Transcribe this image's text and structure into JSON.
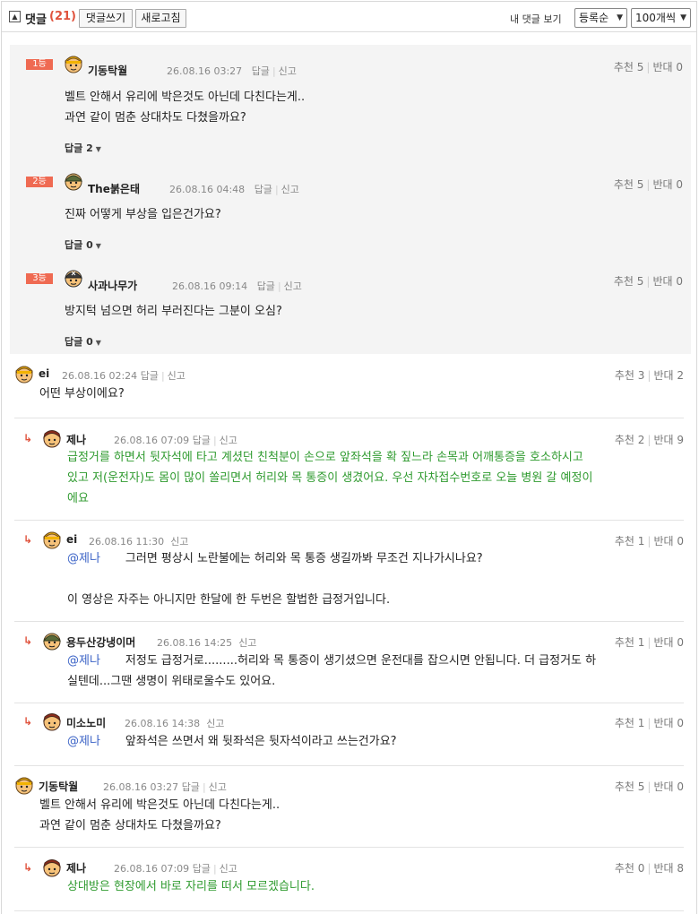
{
  "toolbar": {
    "toggle_icon": "minus-box-icon",
    "title": "댓글",
    "count": "(21)",
    "write_button": "댓글쓰기",
    "refresh_button": "새로고침",
    "my_comments": "내 댓글 보기",
    "order_select": "등록순",
    "count_select": "100개씩"
  },
  "best_comments": [
    {
      "rank": "1등",
      "nick": "기동탁월",
      "date": "26.08.16 03:27",
      "reply_label": "답글",
      "report_label": "신고",
      "up": "추천 5",
      "down": "반대 0",
      "lines": [
        "벨트 안해서 유리에 박은것도 아닌데 다친다는게..",
        "과연 같이 멈춘 상대차도 다쳤을까요?"
      ],
      "replies": "답글 2"
    },
    {
      "rank": "2등",
      "nick": "The붉은태",
      "date": "26.08.16 04:48",
      "reply_label": "답글",
      "report_label": "신고",
      "up": "추천 5",
      "down": "반대 0",
      "lines": [
        "진짜 어떻게 부상을 입은건가요?"
      ],
      "replies": "답글 0"
    },
    {
      "rank": "3등",
      "nick": "사과나무가",
      "date": "26.08.16 09:14",
      "reply_label": "답글",
      "report_label": "신고",
      "up": "추천 5",
      "down": "반대 0",
      "lines": [
        "방지턱 넘으면 허리 부러진다는 그분이 오심?"
      ],
      "replies": "답글 0"
    }
  ],
  "comments": [
    {
      "nick": "ei",
      "date": "26.08.16 02:24",
      "reply_label": "답글",
      "report_label": "신고",
      "up": "추천 3",
      "down": "반대 2",
      "lines": [
        "어떤 부상이에요?"
      ]
    },
    {
      "nick": "제나",
      "date": "26.08.16 07:09",
      "reply_label": "답글",
      "report_label": "신고",
      "up": "추천 2",
      "down": "반대 9",
      "lines": [
        "급정거를 하면서 뒷자석에 타고 계셨던 친척분이 손으로 앞좌석을 확 짚느라 손목과 어깨통증을 호소하시고",
        "있고 저(운전자)도 몸이 많이 쏠리면서 허리와 목 통증이 생겼어요. 우선 자차접수번호로 오늘 병원 갈 예정이",
        "에요"
      ]
    },
    {
      "nick": "ei",
      "date": "26.08.16 11:30",
      "report_label": "신고",
      "up": "추천 1",
      "down": "반대 0",
      "mention": "@제나",
      "lines": [
        "그러면 평상시 노란불에는 허리와 목 통증 생길까봐 무조건 지나가시나요?",
        "",
        "이 영상은 자주는 아니지만 한달에 한 두번은 할법한 급정거입니다."
      ]
    },
    {
      "nick": "용두산강냉이머",
      "date": "26.08.16 14:25",
      "report_label": "신고",
      "up": "추천 1",
      "down": "반대 0",
      "mention": "@제나",
      "lines": [
        "저정도 급정거로.........허리와 목 통증이 생기셨으면 운전대를 잡으시면 안됩니다. 더 급정거도 하",
        "실텐데...그땐 생명이 위태로울수도 있어요."
      ]
    },
    {
      "nick": "미소노미",
      "date": "26.08.16 14:38",
      "report_label": "신고",
      "up": "추천 1",
      "down": "반대 0",
      "mention": "@제나",
      "lines": [
        "앞좌석은 쓰면서 왜 뒷좌석은 뒷자석이라고 쓰는건가요?"
      ]
    },
    {
      "nick": "기동탁월",
      "date": "26.08.16 03:27",
      "reply_label": "답글",
      "report_label": "신고",
      "up": "추천 5",
      "down": "반대 0",
      "lines": [
        "벨트 안해서 유리에 박은것도 아닌데 다친다는게..",
        "과연 같이 멈춘 상대차도 다쳤을까요?"
      ]
    },
    {
      "nick": "제나",
      "date": "26.08.16 07:09",
      "reply_label": "답글",
      "report_label": "신고",
      "up": "추천 0",
      "down": "반대 8",
      "lines": [
        "상대방은 현장에서 바로 자리를 떠서 모르겠습니다."
      ]
    }
  ],
  "colors": {
    "accent": "#e0533d",
    "rank_badge": "#ef6a52",
    "author_text": "#2e9a2e",
    "mention": "#3a62c6"
  }
}
